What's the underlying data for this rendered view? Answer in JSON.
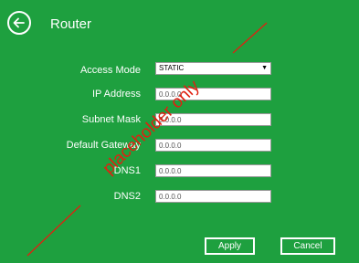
{
  "header": {
    "title": "Router"
  },
  "form": {
    "access_mode": {
      "label": "Access Mode",
      "value": "STATIC"
    },
    "ip_address": {
      "label": "IP Address",
      "value": "0.0.0.0"
    },
    "subnet_mask": {
      "label": "Subnet Mask",
      "value": "0.0.0.0"
    },
    "default_gateway": {
      "label": "Default Gateway",
      "value": "0.0.0.0"
    },
    "dns1": {
      "label": "DNS1",
      "value": "0.0.0.0"
    },
    "dns2": {
      "label": "DNS2",
      "value": "0.0.0.0"
    }
  },
  "buttons": {
    "apply": "Apply",
    "cancel": "Cancel"
  },
  "watermark": {
    "text": "placeholder only"
  },
  "colors": {
    "background": "#1ea03f",
    "watermark": "#e02010"
  }
}
